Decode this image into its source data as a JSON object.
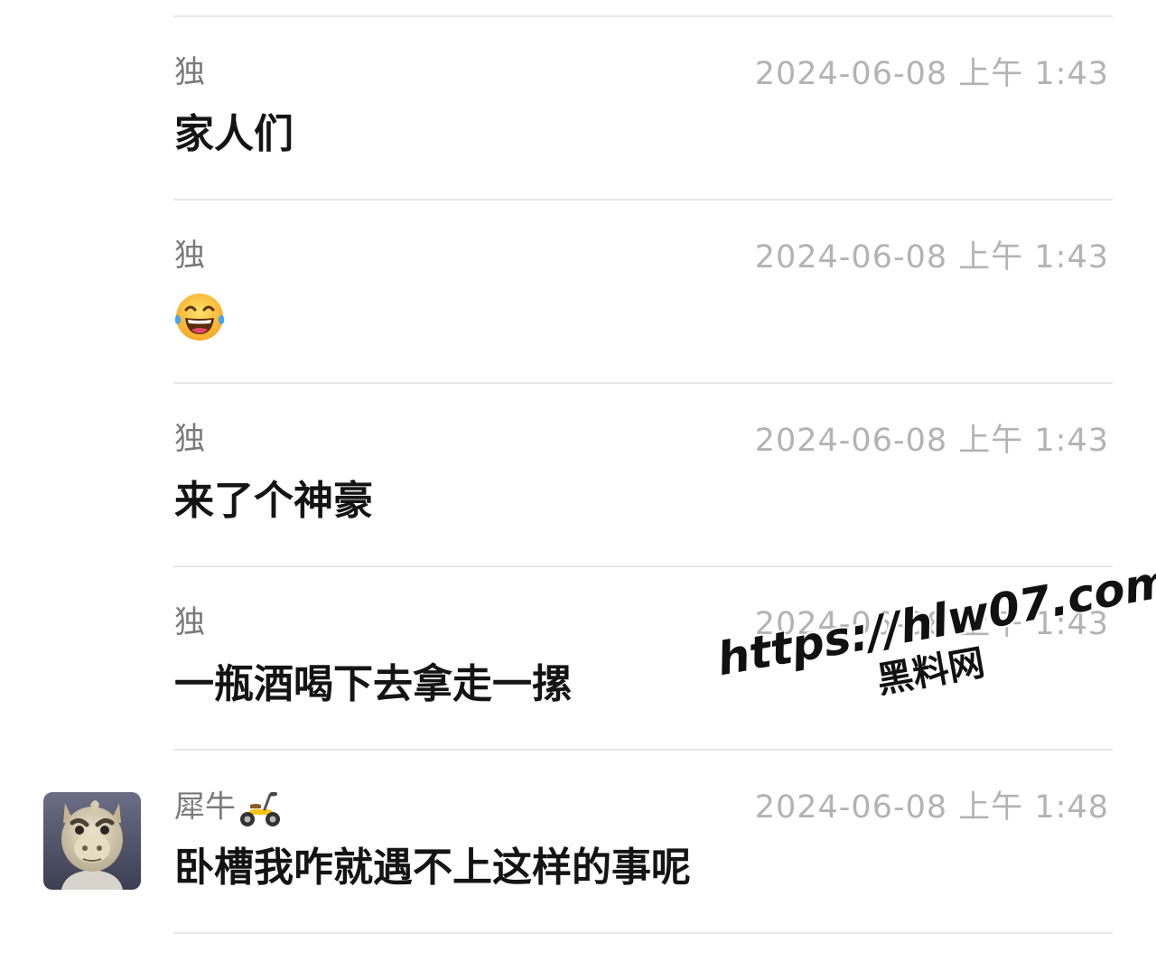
{
  "messages": [
    {
      "sender": "独",
      "timestamp": "2024-06-08 上午 1:43",
      "text": "家人们"
    },
    {
      "sender": "独",
      "timestamp": "2024-06-08 上午 1:43",
      "text": "",
      "emoji": "face-with-tears-of-joy-icon"
    },
    {
      "sender": "独",
      "timestamp": "2024-06-08 上午 1:43",
      "text": "来了个神豪"
    },
    {
      "sender": "独",
      "timestamp": "2024-06-08 上午 1:43",
      "text": "一瓶酒喝下去拿走一摞"
    },
    {
      "sender": "犀牛",
      "sender_badge": "scooter-icon",
      "avatar": "rhino-avatar",
      "timestamp": "2024-06-08 上午 1:48",
      "text": "卧槽我咋就遇不上这样的事呢"
    }
  ],
  "watermark": {
    "url": "https://hlw07.com",
    "name": "黑料网"
  },
  "colors": {
    "sender": "#7a7a7a",
    "timestamp": "#b3b3b3",
    "text": "#141414",
    "divider": "#e8e8e8",
    "background": "#ffffff"
  }
}
